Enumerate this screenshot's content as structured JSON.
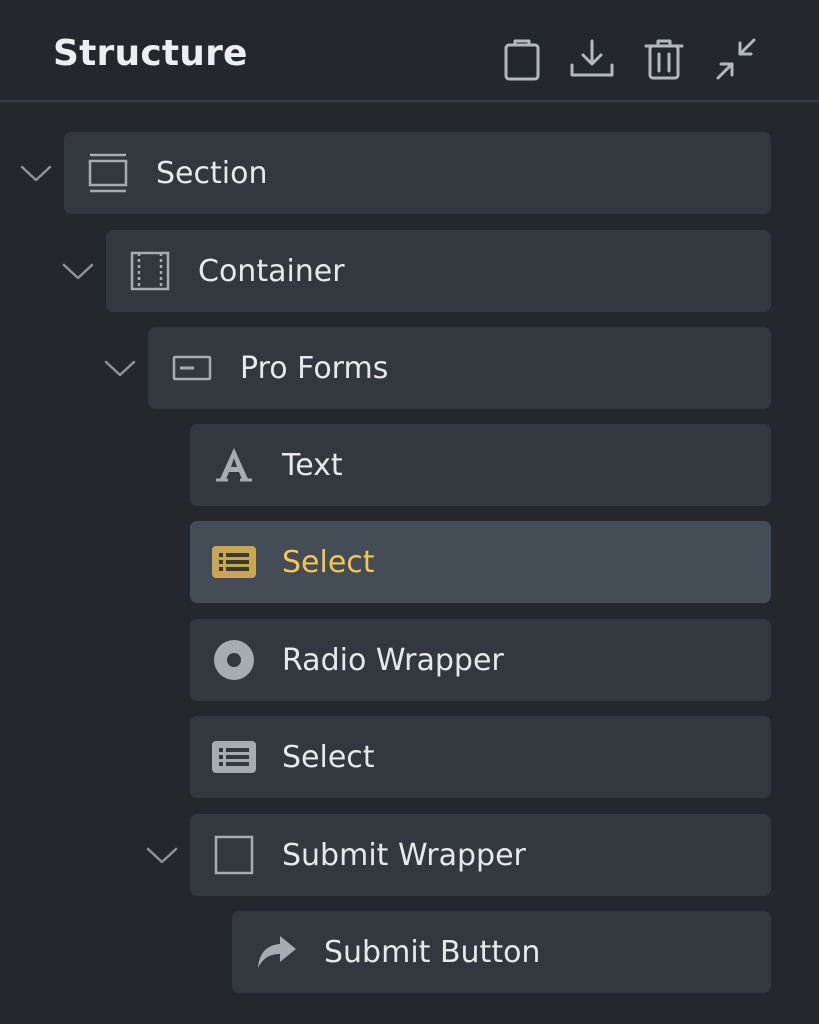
{
  "panel": {
    "title": "Structure"
  },
  "toolbar": {
    "icons": [
      "clipboard-icon",
      "download-icon",
      "trash-icon",
      "collapse-icon"
    ]
  },
  "tree": [
    {
      "label": "Section",
      "icon": "section-icon",
      "expanded": true
    },
    {
      "label": "Container",
      "icon": "container-icon",
      "expanded": true
    },
    {
      "label": "Pro Forms",
      "icon": "form-icon",
      "expanded": true
    },
    {
      "label": "Text",
      "icon": "text-icon"
    },
    {
      "label": "Select",
      "icon": "list-icon",
      "selected": true
    },
    {
      "label": "Radio Wrapper",
      "icon": "radio-icon"
    },
    {
      "label": "Select",
      "icon": "list-icon"
    },
    {
      "label": "Submit Wrapper",
      "icon": "square-icon",
      "expanded": true
    },
    {
      "label": "Submit Button",
      "icon": "share-arrow-icon"
    }
  ],
  "colors": {
    "background": "#24272b",
    "row": "#33383e",
    "row_active": "#444c55",
    "accent": "#f2c45a",
    "icon": "#a7acb1"
  }
}
